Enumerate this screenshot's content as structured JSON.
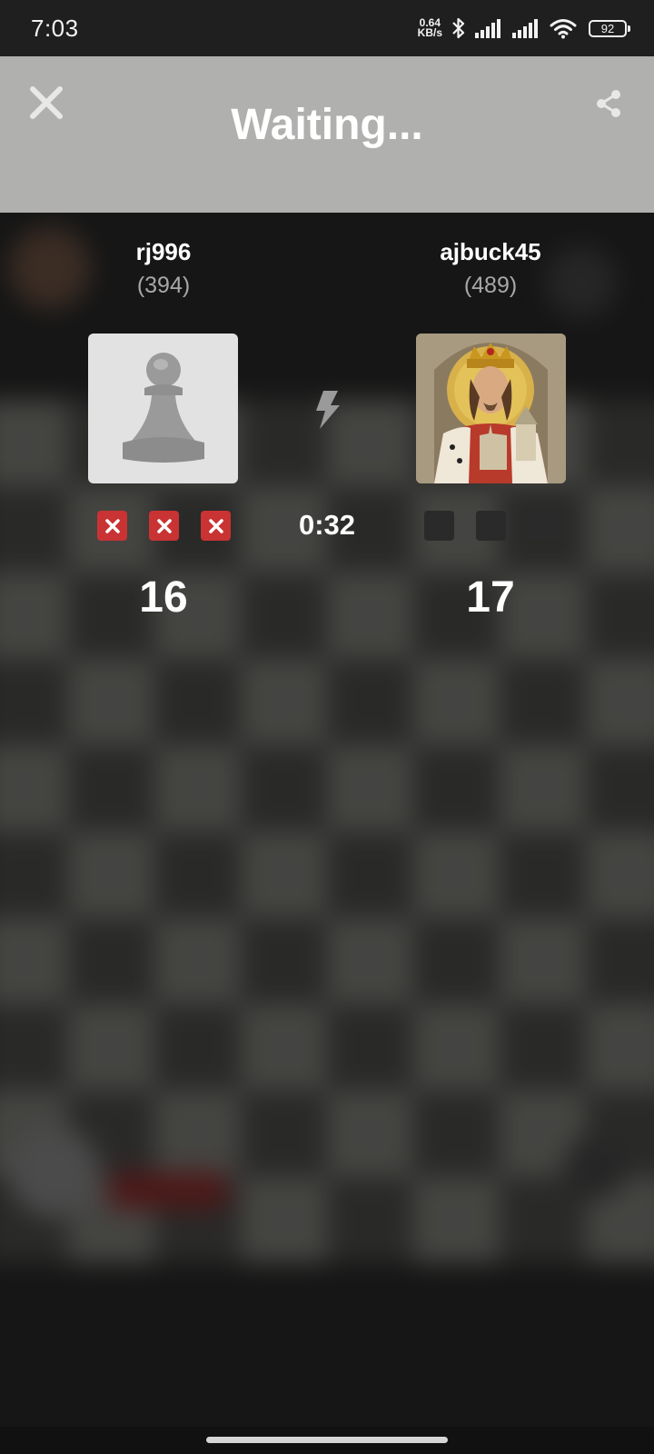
{
  "status_bar": {
    "time": "7:03",
    "net_speed_value": "0.64",
    "net_speed_unit": "KB/s",
    "battery": "92",
    "icons": [
      "bluetooth-icon",
      "signal-icon",
      "signal-icon",
      "wifi-icon",
      "battery-icon"
    ]
  },
  "header": {
    "title": "Waiting...",
    "close_icon": "close-icon",
    "share_icon": "share-icon",
    "background": "#b0b0ae"
  },
  "game": {
    "mode_icon": "lightning-bolt-icon",
    "timer": "0:32",
    "players": [
      {
        "name": "rj996",
        "rating": "(394)",
        "avatar": "pawn-icon",
        "results": [
          "loss",
          "loss",
          "loss"
        ],
        "score": "16"
      },
      {
        "name": "ajbuck45",
        "rating": "(489)",
        "avatar": "king-portrait",
        "results": [
          "empty",
          "empty",
          "empty"
        ],
        "score": "17"
      }
    ]
  },
  "colors": {
    "loss": "#c93333",
    "empty": "#2a2a2a",
    "text": "#ffffff",
    "rating": "#a8a8a8"
  }
}
